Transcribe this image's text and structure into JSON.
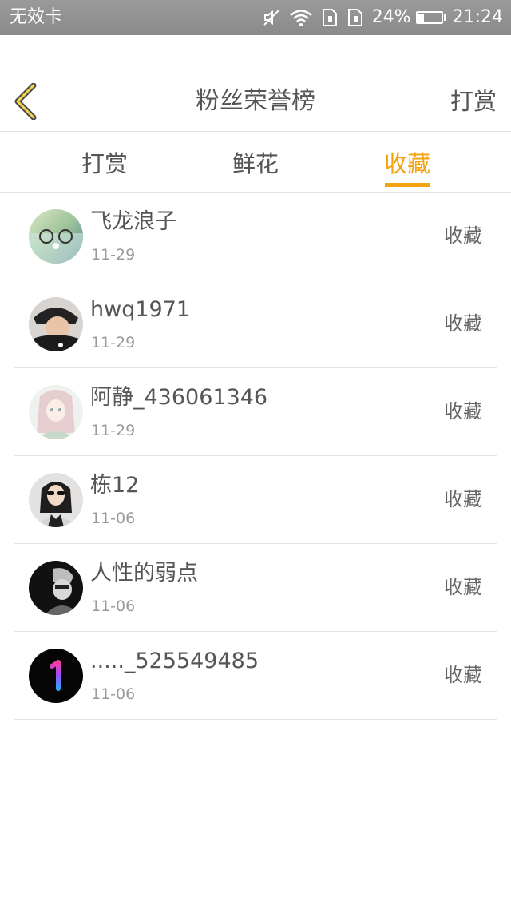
{
  "status_bar": {
    "carrier": "无效卡",
    "battery_percent": "24%",
    "battery_level": 0.24,
    "time": "21:24",
    "icons": [
      "mute-icon",
      "wifi-icon",
      "sim1-icon",
      "sim2-icon",
      "battery-icon"
    ]
  },
  "header": {
    "back_icon": "chevron-left-icon",
    "title": "粉丝荣誉榜",
    "action_label": "打赏"
  },
  "tabs": [
    {
      "label": "打赏",
      "active": false
    },
    {
      "label": "鲜花",
      "active": false
    },
    {
      "label": "收藏",
      "active": true
    }
  ],
  "list": [
    {
      "name": "飞龙浪子",
      "date": "11-29",
      "action": "收藏",
      "avatar": "user-avatar-1"
    },
    {
      "name": "hwq1971",
      "date": "11-29",
      "action": "收藏",
      "avatar": "user-avatar-2"
    },
    {
      "name": "阿静_436061346",
      "date": "11-29",
      "action": "收藏",
      "avatar": "user-avatar-3"
    },
    {
      "name": "栋12",
      "date": "11-06",
      "action": "收藏",
      "avatar": "user-avatar-4"
    },
    {
      "name": "人性的弱点",
      "date": "11-06",
      "action": "收藏",
      "avatar": "user-avatar-5"
    },
    {
      "name": "....._525549485",
      "date": "11-06",
      "action": "收藏",
      "avatar": "user-avatar-6"
    }
  ],
  "colors": {
    "accent": "#f2a30f",
    "text": "#555555",
    "muted": "#999999",
    "divider": "#e3e3e3",
    "status_bar": "#8f8f8f"
  }
}
